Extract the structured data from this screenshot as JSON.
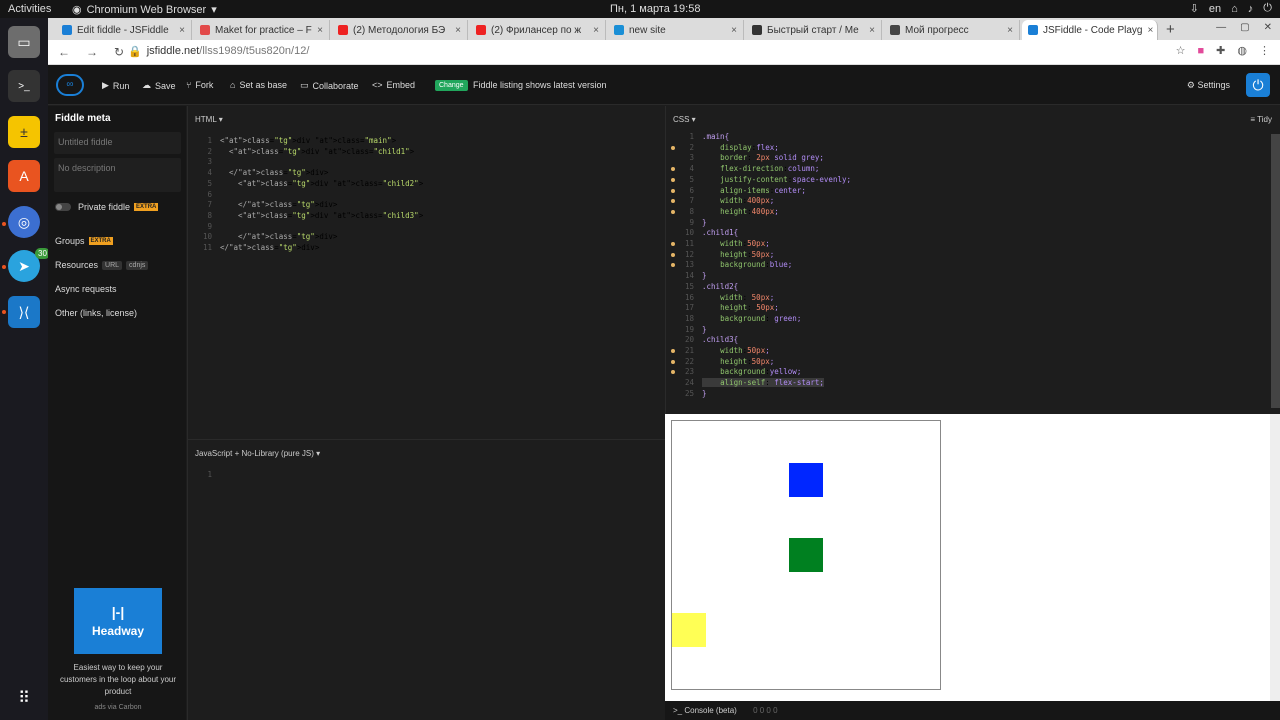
{
  "os": {
    "activities": "Activities",
    "app_name": "Chromium Web Browser",
    "clock": "Пн, 1 марта  19:58",
    "lang": "en",
    "telegram_badge": "30"
  },
  "tabs": [
    {
      "label": "Edit fiddle - JSFiddle",
      "color": "#1a7fd6"
    },
    {
      "label": "Maket for practice – F",
      "color": "#e24a4a"
    },
    {
      "label": "(2) Методология БЭ",
      "color": "#e22"
    },
    {
      "label": "(2) Фрилансер по ж",
      "color": "#e22"
    },
    {
      "label": "new site",
      "color": "#1a8fd6"
    },
    {
      "label": "Быстрый старт / Ме",
      "color": "#333"
    },
    {
      "label": "Мой прогресс",
      "color": "#444"
    },
    {
      "label": "JSFiddle - Code Playg",
      "color": "#1a7fd6"
    }
  ],
  "address": {
    "host": "jsfiddle.net",
    "path": "/llss1989/t5us820n/12/"
  },
  "toolbar": {
    "run": "Run",
    "save": "Save",
    "fork": "Fork",
    "set_base": "Set as base",
    "collaborate": "Collaborate",
    "embed": "Embed",
    "change": "Change",
    "listing": "Fiddle listing shows latest version",
    "settings": "Settings"
  },
  "sidebar": {
    "title": "Fiddle meta",
    "name_placeholder": "Untitled fiddle",
    "desc_placeholder": "No description",
    "private": "Private fiddle",
    "extra": "EXTRA",
    "groups": "Groups",
    "resources": "Resources",
    "url_tag": "URL",
    "cdnjs_tag": "cdnjs",
    "async": "Async requests",
    "other": "Other (links, license)",
    "ad_logo": "|-|",
    "ad_name": "Headway",
    "ad_text": "Easiest way to keep your customers in the loop about your product",
    "ad_by": "ads via Carbon"
  },
  "html_pane": {
    "label": "HTML ▾",
    "lines": [
      "<div class=\"main\">",
      "  <div class=\"child1\">",
      "",
      "  </div>",
      "    <div class=\"child2\">",
      "",
      "    </div>",
      "    <div class=\"child3\">",
      "",
      "    </div>",
      "</div>"
    ]
  },
  "js_pane": {
    "label": "JavaScript + No-Library (pure JS) ▾",
    "lines": [
      ""
    ]
  },
  "css_pane": {
    "label": "CSS ▾",
    "tidy": "Tidy",
    "lines": [
      ".main{",
      "    display:flex;",
      "    border: 2px solid grey;",
      "    flex-direction:column;",
      "    justify-content:space-evenly;",
      "    align-items:center;",
      "    width:400px;",
      "    height:400px;",
      "}",
      ".child1{",
      "    width:50px;",
      "    height:50px;",
      "    background:blue;",
      "}",
      ".child2{",
      "    width: 50px;",
      "    height: 50px;",
      "    background: green;",
      "}",
      ".child3{",
      "    width:50px;",
      "    height:50px;",
      "    background:yellow;",
      "    align-self: flex-start;",
      "}"
    ]
  },
  "result": {
    "child1": "#0026ff",
    "child2": "#008020",
    "child3": "#ffff55"
  },
  "console": {
    "label": "Console (beta)",
    "counts": "0  0  0  0"
  }
}
